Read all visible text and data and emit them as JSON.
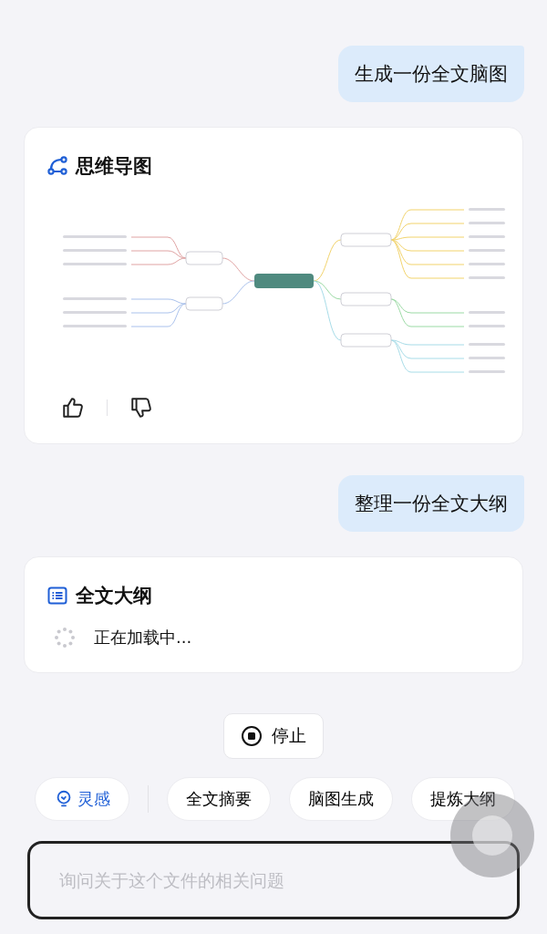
{
  "messages": [
    {
      "kind": "user",
      "text": "生成一份全文脑图"
    },
    {
      "kind": "mindmap",
      "title": "思维导图",
      "feedback": {
        "liked": false,
        "disliked": false
      }
    },
    {
      "kind": "user",
      "text": "整理一份全文大纲"
    },
    {
      "kind": "outline",
      "title": "全文大纲",
      "status": "正在加载中..."
    }
  ],
  "stop_button": "停止",
  "chips": [
    {
      "kind": "accent",
      "label": "灵感"
    },
    {
      "kind": "plain",
      "label": "全文摘要"
    },
    {
      "kind": "plain",
      "label": "脑图生成"
    },
    {
      "kind": "plain",
      "label": "提炼大纲"
    }
  ],
  "input": {
    "placeholder": "询问关于这个文件的相关问题"
  }
}
